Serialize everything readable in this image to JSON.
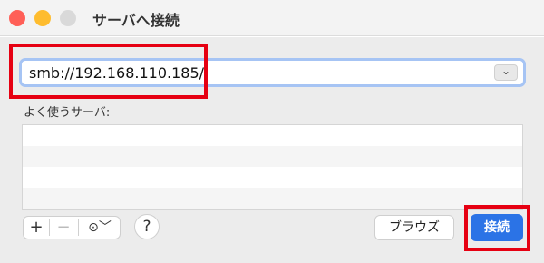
{
  "window": {
    "title": "サーバへ接続"
  },
  "address": {
    "value": "smb://192.168.110.185/",
    "dropdown_icon": "chevron-down-icon"
  },
  "favorites": {
    "label": "よく使うサーバ:",
    "rows": [
      "",
      "",
      "",
      ""
    ]
  },
  "toolbar": {
    "add_label": "+",
    "remove_label": "−",
    "more_label": "⊙﹀",
    "help_label": "?"
  },
  "buttons": {
    "browse_label": "ブラウズ",
    "connect_label": "接続"
  },
  "colors": {
    "accent": "#2b73e6",
    "highlight": "#e60012"
  }
}
